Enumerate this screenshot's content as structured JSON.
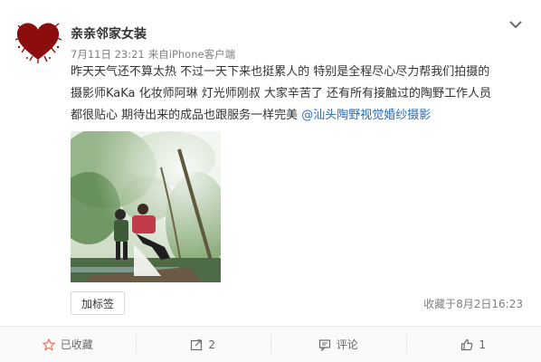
{
  "post": {
    "username": "亲亲邻家女装",
    "date": "7月11日 23:21",
    "source_prefix": "来自",
    "source": "iPhone客户端",
    "text_lines": [
      "昨天天气还不算太热 不过一天下来也挺累人的 特别是全程尽心尽力帮我们拍摄的",
      "摄影师KaKa 化妆师阿琳 灯光师刚叔 大家辛苦了 还有所有接触过的陶野工作人员",
      "都很贴心 期待出来的成品也跟服务一样完美 "
    ],
    "mention": "@汕头陶野视觉婚纱摄影",
    "tag_button": "加标签",
    "favorited_time": "收藏于8月2日16:23"
  },
  "actions": {
    "favorite": "已收藏",
    "repost": "2",
    "comment": "评论",
    "like": "1"
  },
  "colors": {
    "accent": "#eb7350",
    "link": "#2a6bb3",
    "muted": "#808080"
  }
}
